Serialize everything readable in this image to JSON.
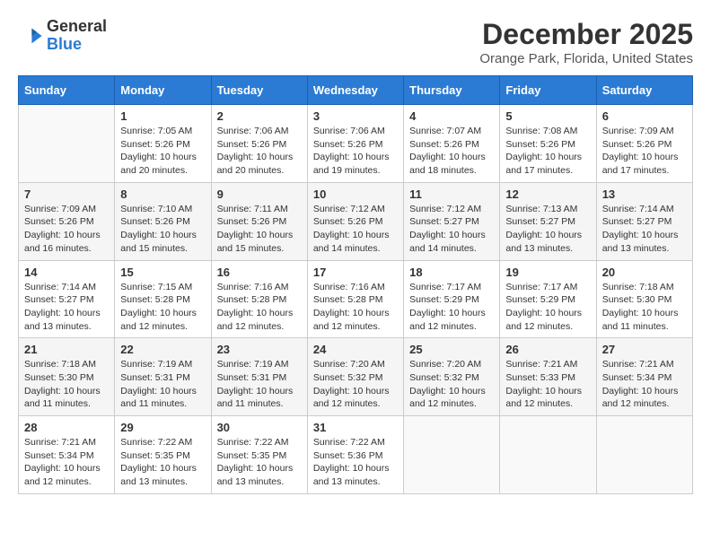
{
  "logo": {
    "text_general": "General",
    "text_blue": "Blue"
  },
  "header": {
    "title": "December 2025",
    "subtitle": "Orange Park, Florida, United States"
  },
  "weekdays": [
    "Sunday",
    "Monday",
    "Tuesday",
    "Wednesday",
    "Thursday",
    "Friday",
    "Saturday"
  ],
  "weeks": [
    [
      {
        "day": "",
        "info": ""
      },
      {
        "day": "1",
        "info": "Sunrise: 7:05 AM\nSunset: 5:26 PM\nDaylight: 10 hours\nand 20 minutes."
      },
      {
        "day": "2",
        "info": "Sunrise: 7:06 AM\nSunset: 5:26 PM\nDaylight: 10 hours\nand 20 minutes."
      },
      {
        "day": "3",
        "info": "Sunrise: 7:06 AM\nSunset: 5:26 PM\nDaylight: 10 hours\nand 19 minutes."
      },
      {
        "day": "4",
        "info": "Sunrise: 7:07 AM\nSunset: 5:26 PM\nDaylight: 10 hours\nand 18 minutes."
      },
      {
        "day": "5",
        "info": "Sunrise: 7:08 AM\nSunset: 5:26 PM\nDaylight: 10 hours\nand 17 minutes."
      },
      {
        "day": "6",
        "info": "Sunrise: 7:09 AM\nSunset: 5:26 PM\nDaylight: 10 hours\nand 17 minutes."
      }
    ],
    [
      {
        "day": "7",
        "info": "Sunrise: 7:09 AM\nSunset: 5:26 PM\nDaylight: 10 hours\nand 16 minutes."
      },
      {
        "day": "8",
        "info": "Sunrise: 7:10 AM\nSunset: 5:26 PM\nDaylight: 10 hours\nand 15 minutes."
      },
      {
        "day": "9",
        "info": "Sunrise: 7:11 AM\nSunset: 5:26 PM\nDaylight: 10 hours\nand 15 minutes."
      },
      {
        "day": "10",
        "info": "Sunrise: 7:12 AM\nSunset: 5:26 PM\nDaylight: 10 hours\nand 14 minutes."
      },
      {
        "day": "11",
        "info": "Sunrise: 7:12 AM\nSunset: 5:27 PM\nDaylight: 10 hours\nand 14 minutes."
      },
      {
        "day": "12",
        "info": "Sunrise: 7:13 AM\nSunset: 5:27 PM\nDaylight: 10 hours\nand 13 minutes."
      },
      {
        "day": "13",
        "info": "Sunrise: 7:14 AM\nSunset: 5:27 PM\nDaylight: 10 hours\nand 13 minutes."
      }
    ],
    [
      {
        "day": "14",
        "info": "Sunrise: 7:14 AM\nSunset: 5:27 PM\nDaylight: 10 hours\nand 13 minutes."
      },
      {
        "day": "15",
        "info": "Sunrise: 7:15 AM\nSunset: 5:28 PM\nDaylight: 10 hours\nand 12 minutes."
      },
      {
        "day": "16",
        "info": "Sunrise: 7:16 AM\nSunset: 5:28 PM\nDaylight: 10 hours\nand 12 minutes."
      },
      {
        "day": "17",
        "info": "Sunrise: 7:16 AM\nSunset: 5:28 PM\nDaylight: 10 hours\nand 12 minutes."
      },
      {
        "day": "18",
        "info": "Sunrise: 7:17 AM\nSunset: 5:29 PM\nDaylight: 10 hours\nand 12 minutes."
      },
      {
        "day": "19",
        "info": "Sunrise: 7:17 AM\nSunset: 5:29 PM\nDaylight: 10 hours\nand 12 minutes."
      },
      {
        "day": "20",
        "info": "Sunrise: 7:18 AM\nSunset: 5:30 PM\nDaylight: 10 hours\nand 11 minutes."
      }
    ],
    [
      {
        "day": "21",
        "info": "Sunrise: 7:18 AM\nSunset: 5:30 PM\nDaylight: 10 hours\nand 11 minutes."
      },
      {
        "day": "22",
        "info": "Sunrise: 7:19 AM\nSunset: 5:31 PM\nDaylight: 10 hours\nand 11 minutes."
      },
      {
        "day": "23",
        "info": "Sunrise: 7:19 AM\nSunset: 5:31 PM\nDaylight: 10 hours\nand 11 minutes."
      },
      {
        "day": "24",
        "info": "Sunrise: 7:20 AM\nSunset: 5:32 PM\nDaylight: 10 hours\nand 12 minutes."
      },
      {
        "day": "25",
        "info": "Sunrise: 7:20 AM\nSunset: 5:32 PM\nDaylight: 10 hours\nand 12 minutes."
      },
      {
        "day": "26",
        "info": "Sunrise: 7:21 AM\nSunset: 5:33 PM\nDaylight: 10 hours\nand 12 minutes."
      },
      {
        "day": "27",
        "info": "Sunrise: 7:21 AM\nSunset: 5:34 PM\nDaylight: 10 hours\nand 12 minutes."
      }
    ],
    [
      {
        "day": "28",
        "info": "Sunrise: 7:21 AM\nSunset: 5:34 PM\nDaylight: 10 hours\nand 12 minutes."
      },
      {
        "day": "29",
        "info": "Sunrise: 7:22 AM\nSunset: 5:35 PM\nDaylight: 10 hours\nand 13 minutes."
      },
      {
        "day": "30",
        "info": "Sunrise: 7:22 AM\nSunset: 5:35 PM\nDaylight: 10 hours\nand 13 minutes."
      },
      {
        "day": "31",
        "info": "Sunrise: 7:22 AM\nSunset: 5:36 PM\nDaylight: 10 hours\nand 13 minutes."
      },
      {
        "day": "",
        "info": ""
      },
      {
        "day": "",
        "info": ""
      },
      {
        "day": "",
        "info": ""
      }
    ]
  ]
}
